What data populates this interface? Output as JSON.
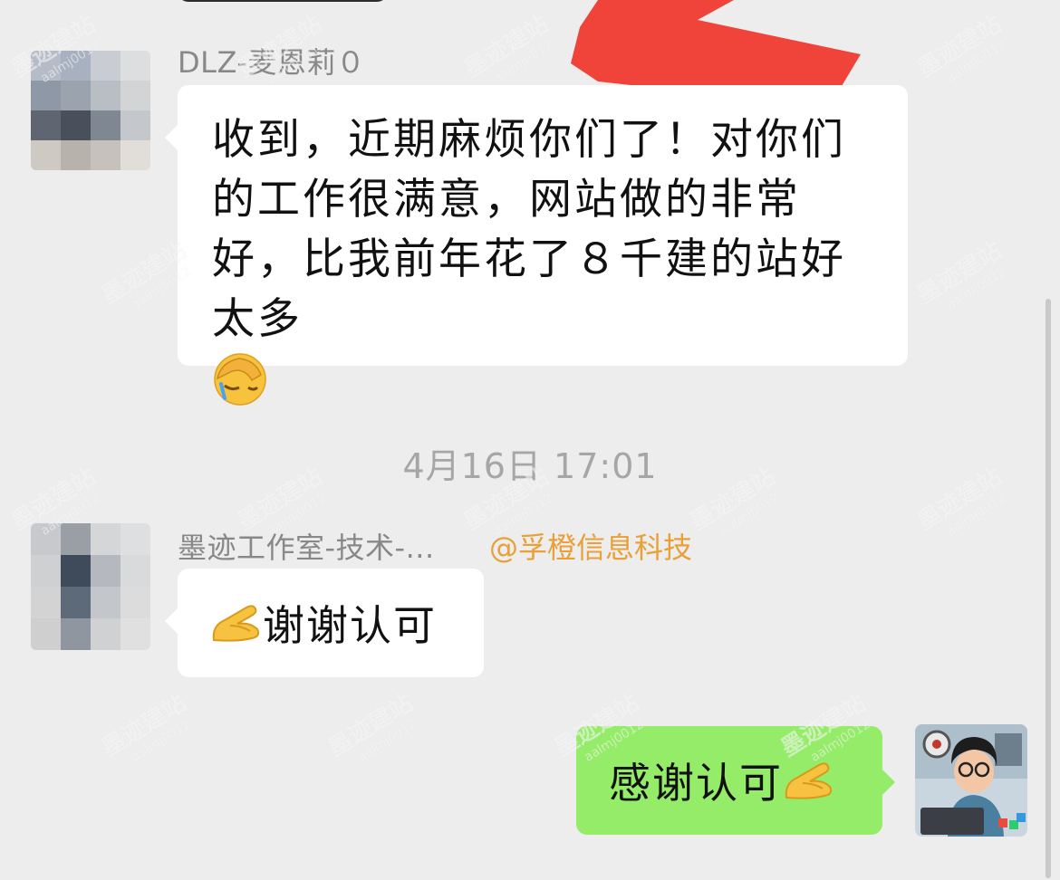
{
  "messages": [
    {
      "sender": "DLZ-麦恩莉０",
      "text": "收到，近期麻烦你们了！对你们的工作很满意，网站做的非常好，比我前年花了８千建的站好太多",
      "emoji": "facepalm-emoji"
    },
    {
      "sender": "墨迹工作室-技术-...",
      "mention": "@孚橙信息科技",
      "text": "谢谢认可",
      "emoji": "pinched-hand-emoji"
    },
    {
      "text": "感谢认可",
      "emoji": "pinched-hand-emoji"
    }
  ],
  "timestamp": "4月16日 17:01",
  "watermark": {
    "title": "墨迹建站",
    "subtitle": "aalmj0012"
  },
  "colors": {
    "background": "#ededed",
    "incoming_bubble": "#ffffff",
    "outgoing_bubble": "#95ec69",
    "mention": "#e8a037",
    "timestamp": "#a6a6a6",
    "sender_name": "#888888"
  }
}
